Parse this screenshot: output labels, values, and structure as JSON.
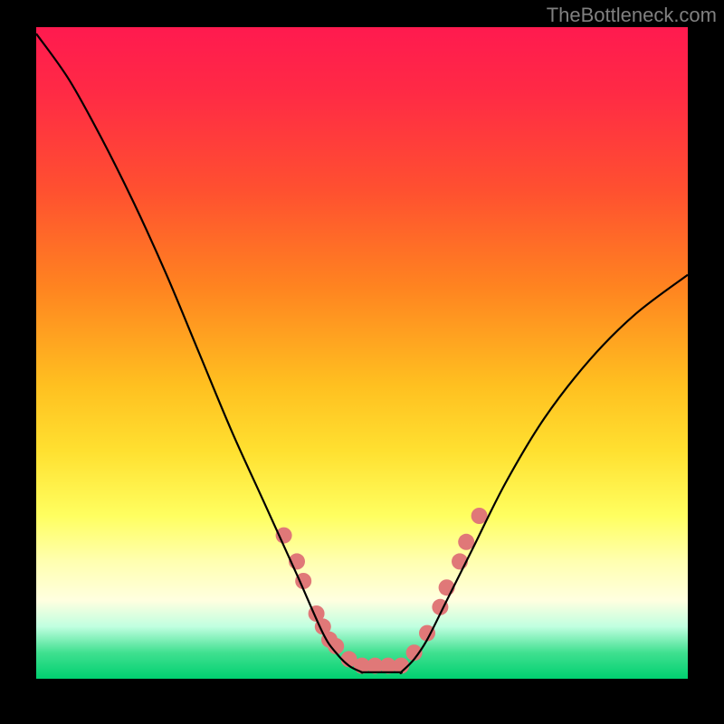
{
  "watermark": "TheBottleneck.com",
  "chart_data": {
    "type": "line",
    "title": "",
    "xlabel": "",
    "ylabel": "",
    "xlim": [
      0,
      100
    ],
    "ylim": [
      0,
      100
    ],
    "grid": false,
    "legend": false,
    "series": [
      {
        "name": "left-curve",
        "x": [
          0,
          5,
          10,
          15,
          20,
          25,
          30,
          35,
          40,
          44,
          46,
          48,
          50
        ],
        "y": [
          99,
          92,
          83,
          73,
          62,
          50,
          38,
          27,
          16,
          7,
          4,
          2,
          1
        ]
      },
      {
        "name": "flat-bottom",
        "x": [
          50,
          52,
          54,
          56
        ],
        "y": [
          1,
          1,
          1,
          1
        ]
      },
      {
        "name": "right-curve",
        "x": [
          56,
          58,
          60,
          63,
          67,
          72,
          78,
          85,
          92,
          100
        ],
        "y": [
          1,
          3,
          6,
          12,
          20,
          30,
          40,
          49,
          56,
          62
        ]
      }
    ],
    "markers": {
      "name": "highlight-points",
      "color": "#e07878",
      "radius": 9,
      "points": [
        {
          "x": 38,
          "y": 22
        },
        {
          "x": 40,
          "y": 18
        },
        {
          "x": 41,
          "y": 15
        },
        {
          "x": 43,
          "y": 10
        },
        {
          "x": 44,
          "y": 8
        },
        {
          "x": 45,
          "y": 6
        },
        {
          "x": 46,
          "y": 5
        },
        {
          "x": 48,
          "y": 3
        },
        {
          "x": 50,
          "y": 2
        },
        {
          "x": 52,
          "y": 2
        },
        {
          "x": 54,
          "y": 2
        },
        {
          "x": 56,
          "y": 2
        },
        {
          "x": 58,
          "y": 4
        },
        {
          "x": 60,
          "y": 7
        },
        {
          "x": 62,
          "y": 11
        },
        {
          "x": 63,
          "y": 14
        },
        {
          "x": 65,
          "y": 18
        },
        {
          "x": 66,
          "y": 21
        },
        {
          "x": 68,
          "y": 25
        }
      ]
    }
  }
}
